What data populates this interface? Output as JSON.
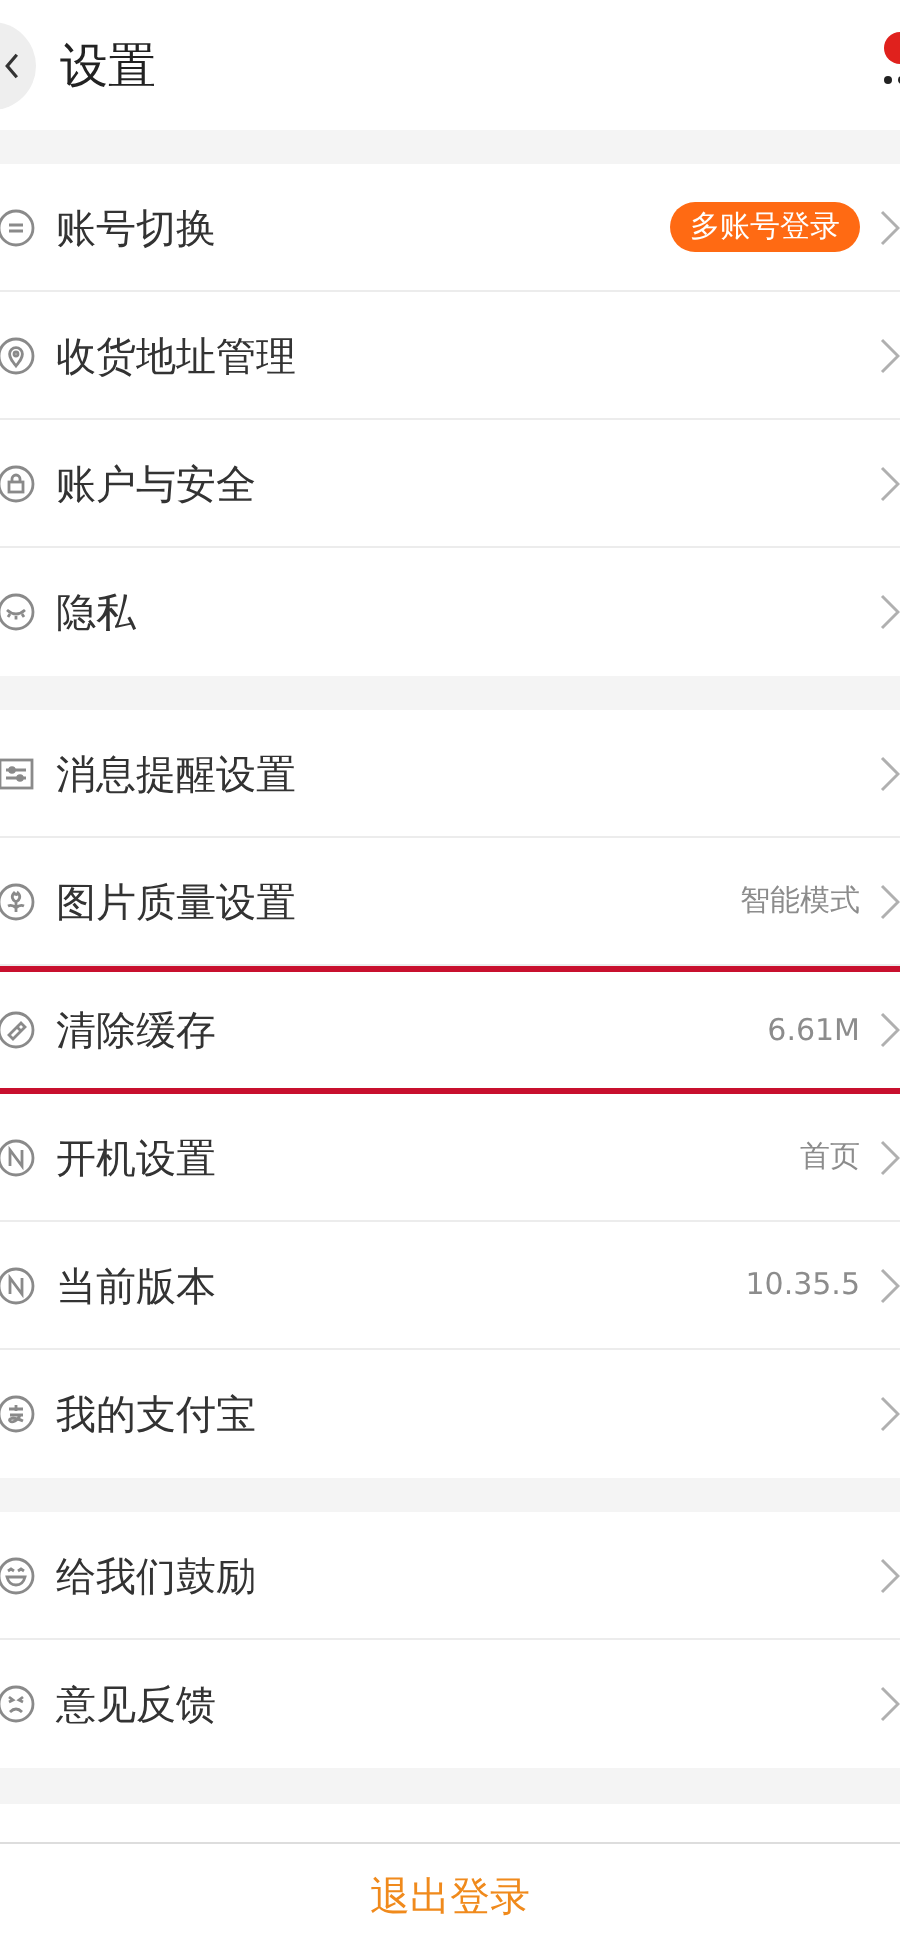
{
  "header": {
    "title": "设置",
    "notification": true
  },
  "groups": [
    {
      "items": [
        {
          "kind": "equals",
          "label": "账号切换",
          "badge": "多账号登录",
          "highlighted": false
        },
        {
          "kind": "pin",
          "label": "收货地址管理",
          "highlighted": false
        },
        {
          "kind": "lock",
          "label": "账户与安全",
          "highlighted": false
        },
        {
          "kind": "eye",
          "label": "隐私",
          "highlighted": false
        }
      ]
    },
    {
      "items": [
        {
          "kind": "sliders",
          "label": "消息提醒设置",
          "highlighted": false
        },
        {
          "kind": "flower",
          "label": "图片质量设置",
          "value": "智能模式",
          "highlighted": false
        },
        {
          "kind": "brush",
          "label": "清除缓存",
          "value": "6.61M",
          "highlighted": true
        },
        {
          "kind": "n",
          "label": "开机设置",
          "value": "首页",
          "highlighted": false
        },
        {
          "kind": "n",
          "label": "当前版本",
          "value": "10.35.5",
          "highlighted": false
        },
        {
          "kind": "pay",
          "label": "我的支付宝",
          "highlighted": false
        }
      ]
    },
    {
      "items": [
        {
          "kind": "smile",
          "label": "给我们鼓励",
          "highlighted": false
        },
        {
          "kind": "sad",
          "label": "意见反馈",
          "highlighted": false
        }
      ]
    }
  ],
  "logout": "退出登录"
}
